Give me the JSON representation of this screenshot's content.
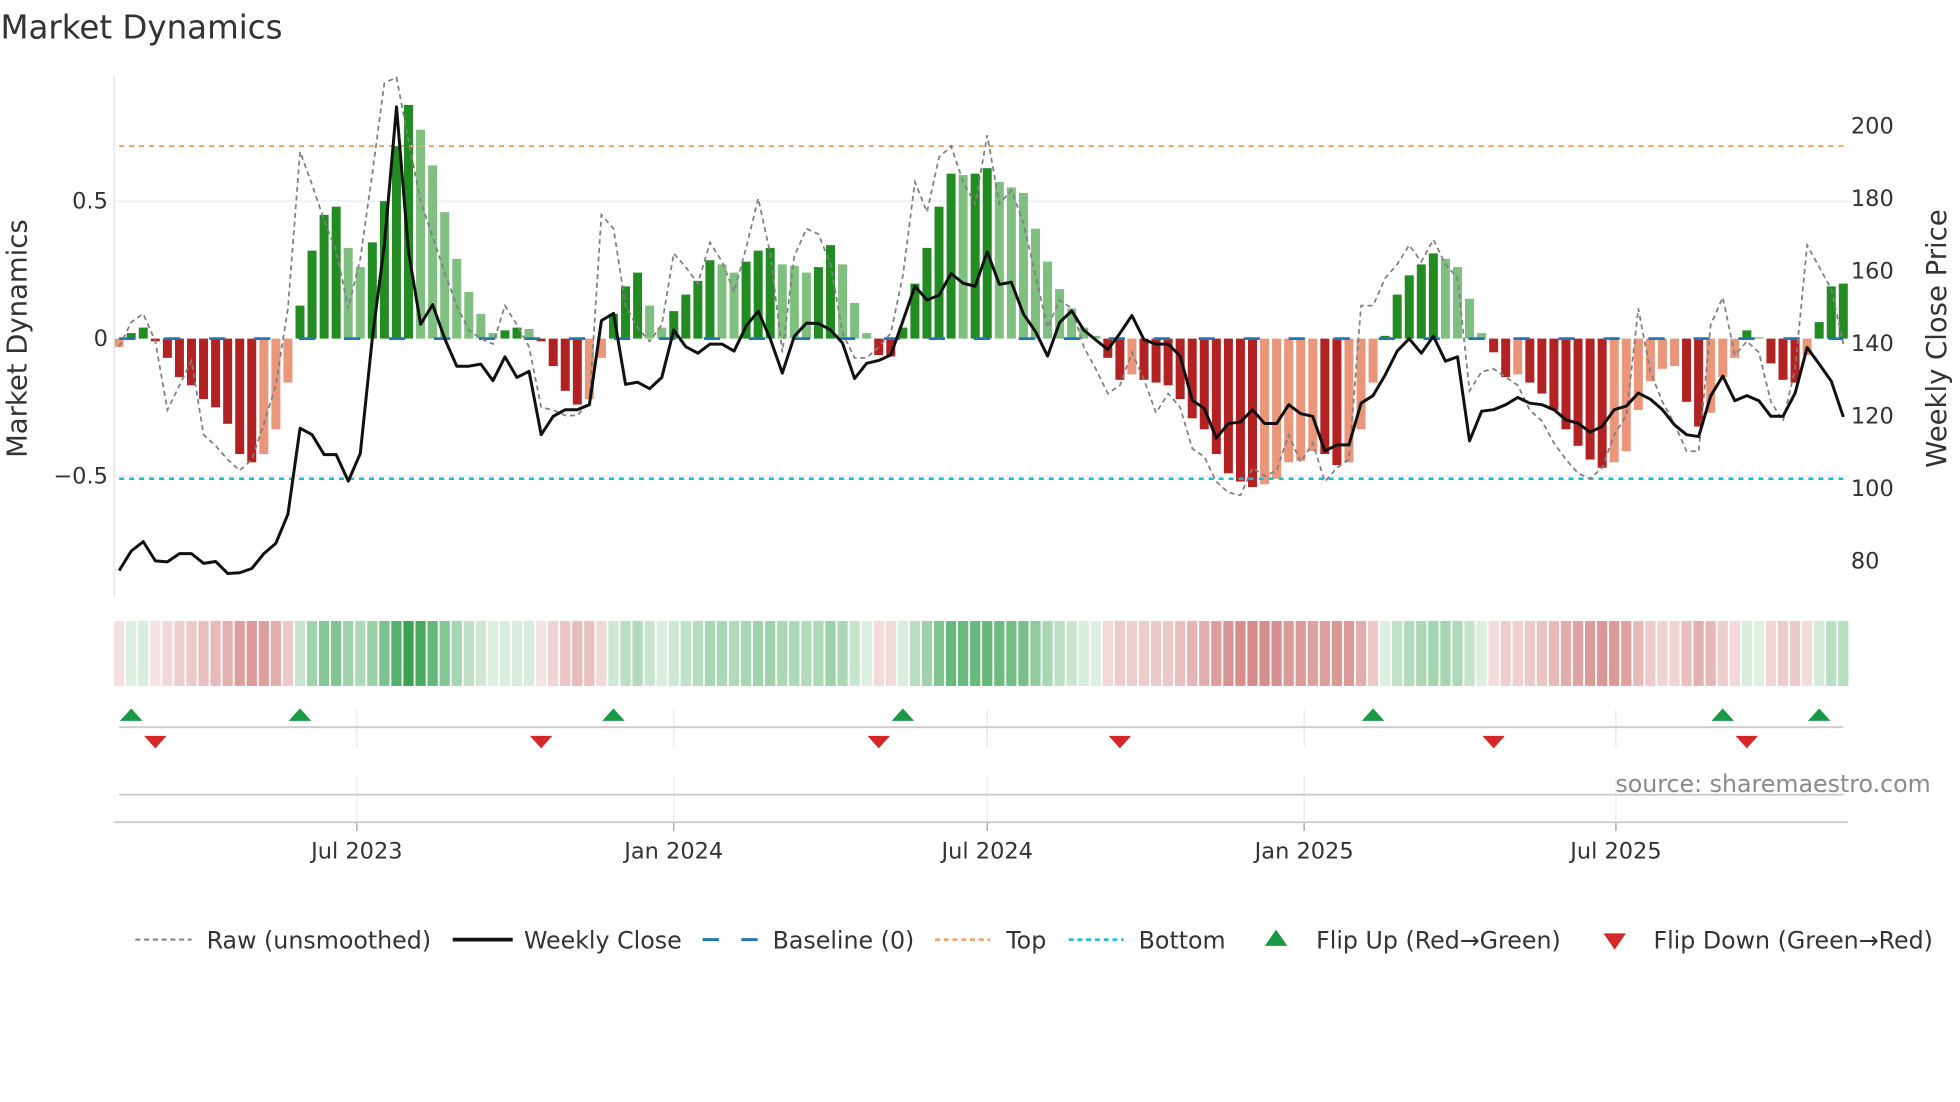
{
  "chart_data": {
    "type": "bar",
    "title": "Market Dynamics",
    "ylabel": "Market Dynamics",
    "ylabel_right": "Weekly Close Price",
    "source": "source: sharemaestro.com",
    "ylim": [
      -0.94,
      0.96
    ],
    "ylim_right": [
      69.7,
      213.8
    ],
    "yticks": [
      {
        "v": 0.5,
        "label": "0.5"
      },
      {
        "v": 0,
        "label": "0"
      },
      {
        "v": -0.5,
        "label": "−0.5"
      }
    ],
    "yticks_right": [
      {
        "v": 200,
        "label": "200"
      },
      {
        "v": 180,
        "label": "180"
      },
      {
        "v": 160,
        "label": "160"
      },
      {
        "v": 140,
        "label": "140"
      },
      {
        "v": 120,
        "label": "120"
      },
      {
        "v": 100,
        "label": "100"
      },
      {
        "v": 80,
        "label": "80"
      }
    ],
    "xticks": [
      {
        "date": "2023-07-01",
        "label": "Jul 2023"
      },
      {
        "date": "2024-01-01",
        "label": "Jan 2024"
      },
      {
        "date": "2024-07-01",
        "label": "Jul 2024"
      },
      {
        "date": "2025-01-01",
        "label": "Jan 2025"
      },
      {
        "date": "2025-07-01",
        "label": "Jul 2025"
      }
    ],
    "grid": true,
    "legend_placement": "bottom",
    "thresholds": {
      "baseline": 0,
      "top": 0.7,
      "bottom": -0.51
    },
    "colors": {
      "pos_rising": "#228b22",
      "pos_falling": "#7fbf7f",
      "neg_falling": "#b22222",
      "neg_rising": "#e9967a",
      "heat_pos": "#2e9e48",
      "heat_neg": "#c0504d",
      "raw": "#808080",
      "close": "#111111",
      "baseline": "#1f77b4",
      "top": "#f0a060",
      "bottom": "#17becf",
      "flip_up": "#1a9a44",
      "flip_down": "#d62728"
    },
    "dates": [
      "2023-02-13",
      "2023-02-20",
      "2023-02-27",
      "2023-03-06",
      "2023-03-13",
      "2023-03-20",
      "2023-03-27",
      "2023-04-03",
      "2023-04-10",
      "2023-04-17",
      "2023-04-24",
      "2023-05-01",
      "2023-05-08",
      "2023-05-15",
      "2023-05-22",
      "2023-05-29",
      "2023-06-05",
      "2023-06-12",
      "2023-06-19",
      "2023-06-26",
      "2023-07-03",
      "2023-07-10",
      "2023-07-17",
      "2023-07-24",
      "2023-07-31",
      "2023-08-07",
      "2023-08-14",
      "2023-08-21",
      "2023-08-28",
      "2023-09-04",
      "2023-09-11",
      "2023-09-18",
      "2023-09-25",
      "2023-10-02",
      "2023-10-09",
      "2023-10-16",
      "2023-10-23",
      "2023-10-30",
      "2023-11-06",
      "2023-11-13",
      "2023-11-20",
      "2023-11-27",
      "2023-12-04",
      "2023-12-11",
      "2023-12-18",
      "2023-12-25",
      "2024-01-01",
      "2024-01-08",
      "2024-01-15",
      "2024-01-22",
      "2024-01-29",
      "2024-02-05",
      "2024-02-12",
      "2024-02-19",
      "2024-02-26",
      "2024-03-04",
      "2024-03-11",
      "2024-03-18",
      "2024-03-25",
      "2024-04-01",
      "2024-04-08",
      "2024-04-15",
      "2024-04-22",
      "2024-04-29",
      "2024-05-06",
      "2024-05-13",
      "2024-05-20",
      "2024-05-27",
      "2024-06-03",
      "2024-06-10",
      "2024-06-17",
      "2024-06-24",
      "2024-07-01",
      "2024-07-08",
      "2024-07-15",
      "2024-07-22",
      "2024-07-29",
      "2024-08-05",
      "2024-08-12",
      "2024-08-19",
      "2024-08-26",
      "2024-09-02",
      "2024-09-09",
      "2024-09-16",
      "2024-09-23",
      "2024-09-30",
      "2024-10-07",
      "2024-10-14",
      "2024-10-21",
      "2024-10-28",
      "2024-11-04",
      "2024-11-11",
      "2024-11-18",
      "2024-11-25",
      "2024-12-02",
      "2024-12-09",
      "2024-12-16",
      "2024-12-23",
      "2024-12-30",
      "2025-01-06",
      "2025-01-13",
      "2025-01-20",
      "2025-01-27",
      "2025-02-03",
      "2025-02-10",
      "2025-02-17",
      "2025-02-24",
      "2025-03-03",
      "2025-03-10",
      "2025-03-17",
      "2025-03-24",
      "2025-03-31",
      "2025-04-07",
      "2025-04-14",
      "2025-04-21",
      "2025-04-28",
      "2025-05-05",
      "2025-05-12",
      "2025-05-19",
      "2025-05-26",
      "2025-06-02",
      "2025-06-09",
      "2025-06-16",
      "2025-06-23",
      "2025-06-30",
      "2025-07-07",
      "2025-07-14",
      "2025-07-21",
      "2025-07-28",
      "2025-08-04",
      "2025-08-11",
      "2025-08-18",
      "2025-08-25",
      "2025-09-01",
      "2025-09-08",
      "2025-09-15",
      "2025-09-22",
      "2025-09-29",
      "2025-10-06",
      "2025-10-13",
      "2025-10-20",
      "2025-10-27",
      "2025-11-03",
      "2025-11-10"
    ],
    "series": [
      {
        "name": "Market Dynamics",
        "values": [
          -0.03,
          0.02,
          0.04,
          -0.01,
          -0.07,
          -0.14,
          -0.17,
          -0.22,
          -0.25,
          -0.31,
          -0.42,
          -0.45,
          -0.42,
          -0.33,
          -0.16,
          0.12,
          0.32,
          0.45,
          0.48,
          0.33,
          0.26,
          0.35,
          0.5,
          0.7,
          0.85,
          0.76,
          0.63,
          0.46,
          0.29,
          0.17,
          0.09,
          0.02,
          0.03,
          0.04,
          0.035,
          -0.01,
          -0.1,
          -0.19,
          -0.24,
          -0.22,
          -0.07,
          0.09,
          0.19,
          0.24,
          0.12,
          0.04,
          0.1,
          0.16,
          0.21,
          0.285,
          0.27,
          0.24,
          0.28,
          0.32,
          0.33,
          0.27,
          0.265,
          0.24,
          0.26,
          0.34,
          0.27,
          0.13,
          0.02,
          -0.06,
          -0.065,
          0.04,
          0.2,
          0.33,
          0.48,
          0.6,
          0.595,
          0.6,
          0.62,
          0.57,
          0.55,
          0.53,
          0.4,
          0.28,
          0.18,
          0.11,
          0.04,
          0.01,
          -0.07,
          -0.15,
          -0.13,
          -0.15,
          -0.16,
          -0.17,
          -0.22,
          -0.29,
          -0.33,
          -0.42,
          -0.49,
          -0.52,
          -0.54,
          -0.53,
          -0.51,
          -0.45,
          -0.445,
          -0.41,
          -0.42,
          -0.46,
          -0.45,
          -0.33,
          -0.16,
          0.01,
          0.16,
          0.23,
          0.27,
          0.31,
          0.29,
          0.26,
          0.145,
          0.02,
          -0.05,
          -0.14,
          -0.13,
          -0.16,
          -0.2,
          -0.26,
          -0.33,
          -0.39,
          -0.44,
          -0.47,
          -0.45,
          -0.41,
          -0.26,
          -0.155,
          -0.11,
          -0.1,
          -0.23,
          -0.32,
          -0.27,
          -0.14,
          -0.07,
          0.03,
          0.005,
          -0.09,
          -0.15,
          -0.16,
          -0.06,
          0.06,
          0.19,
          0.2
        ]
      },
      {
        "name": "Raw (unsmoothed)",
        "values": [
          -0.03,
          0.06,
          0.09,
          -0.01,
          -0.26,
          -0.17,
          -0.08,
          -0.35,
          -0.39,
          -0.44,
          -0.48,
          -0.44,
          -0.31,
          -0.17,
          0.11,
          0.68,
          0.56,
          0.43,
          0.32,
          0.11,
          0.29,
          0.6,
          0.93,
          0.95,
          0.72,
          0.5,
          0.37,
          0.24,
          0.12,
          0.03,
          0.0,
          -0.02,
          0.12,
          0.05,
          -0.03,
          -0.25,
          -0.26,
          -0.28,
          -0.28,
          -0.23,
          0.45,
          0.4,
          0.12,
          0.04,
          -0.01,
          0.05,
          0.31,
          0.26,
          0.2,
          0.35,
          0.28,
          0.17,
          0.33,
          0.51,
          0.31,
          -0.05,
          0.3,
          0.4,
          0.38,
          0.27,
          0.02,
          -0.07,
          -0.07,
          -0.03,
          0.02,
          0.23,
          0.57,
          0.46,
          0.66,
          0.7,
          0.57,
          0.49,
          0.74,
          0.49,
          0.54,
          0.42,
          0.23,
          0.04,
          0.14,
          0.11,
          -0.03,
          -0.11,
          -0.2,
          -0.17,
          -0.05,
          -0.15,
          -0.27,
          -0.2,
          -0.25,
          -0.4,
          -0.43,
          -0.52,
          -0.56,
          -0.57,
          -0.47,
          -0.5,
          -0.48,
          -0.35,
          -0.45,
          -0.38,
          -0.52,
          -0.47,
          -0.44,
          0.12,
          0.12,
          0.22,
          0.27,
          0.34,
          0.28,
          0.36,
          0.27,
          0.22,
          -0.19,
          -0.12,
          -0.11,
          -0.14,
          -0.17,
          -0.26,
          -0.3,
          -0.38,
          -0.44,
          -0.49,
          -0.51,
          -0.47,
          -0.35,
          -0.28,
          0.11,
          -0.12,
          -0.23,
          -0.31,
          -0.41,
          -0.41,
          0.05,
          0.15,
          -0.06,
          -0.01,
          -0.05,
          -0.23,
          -0.3,
          -0.11,
          0.34,
          0.26,
          0.18,
          -0.02
        ]
      },
      {
        "name": "Weekly Close",
        "axis": "right",
        "values": [
          77,
          82.4,
          85,
          79.7,
          79.4,
          81.7,
          81.7,
          79,
          79.5,
          76.2,
          76.4,
          77.6,
          81.7,
          84.5,
          92.6,
          116.3,
          114.5,
          109,
          109,
          101.7,
          109.3,
          141,
          167,
          205,
          165,
          145,
          150.4,
          141,
          133.4,
          133.4,
          134,
          129.4,
          136,
          130.3,
          132,
          114.5,
          119.6,
          121.4,
          121.4,
          122.8,
          146,
          148,
          128.4,
          129,
          127.2,
          130.3,
          143.4,
          138.8,
          137,
          139.5,
          139.5,
          137.6,
          144.5,
          148.6,
          141,
          131.5,
          141.7,
          145.3,
          145.2,
          143.4,
          139.8,
          130,
          134.2,
          135,
          136.5,
          145.9,
          155.5,
          151.7,
          153,
          159,
          156.3,
          155.5,
          165,
          156,
          156.6,
          147.8,
          143,
          136.2,
          145.5,
          148.7,
          143.4,
          140.7,
          138,
          142.5,
          147.4,
          140.7,
          139.5,
          139.5,
          136.2,
          124,
          121.8,
          113.6,
          117.6,
          118,
          121.4,
          117.6,
          117.6,
          122.8,
          120.3,
          119.6,
          110,
          111.7,
          111.7,
          123.2,
          125.3,
          131,
          137.6,
          141,
          137,
          141.7,
          134.8,
          136,
          112.8,
          121,
          121.4,
          122.8,
          124.8,
          123.2,
          122.8,
          121.4,
          118.6,
          117.7,
          115.2,
          116.8,
          121.4,
          122.4,
          126,
          124.3,
          121.4,
          117.2,
          114.5,
          114,
          125.2,
          130.7,
          123.9,
          125.3,
          123.9,
          119.6,
          119.6,
          126,
          138.6,
          134,
          129.3,
          119.4
        ]
      }
    ],
    "flip_up": [
      "2023-02-20",
      "2023-05-29",
      "2023-11-27",
      "2024-05-13",
      "2025-02-10",
      "2025-09-01",
      "2025-10-27"
    ],
    "flip_down": [
      "2023-03-06",
      "2023-10-16",
      "2024-04-29",
      "2024-09-16",
      "2025-04-21",
      "2025-09-15"
    ],
    "legend": [
      {
        "label": "Raw (unsmoothed)"
      },
      {
        "label": "Weekly Close"
      },
      {
        "label": "Baseline (0)"
      },
      {
        "label": "Top"
      },
      {
        "label": "Bottom"
      },
      {
        "label": "Flip Up (Red→Green)"
      },
      {
        "label": "Flip Down (Green→Red)"
      }
    ]
  }
}
